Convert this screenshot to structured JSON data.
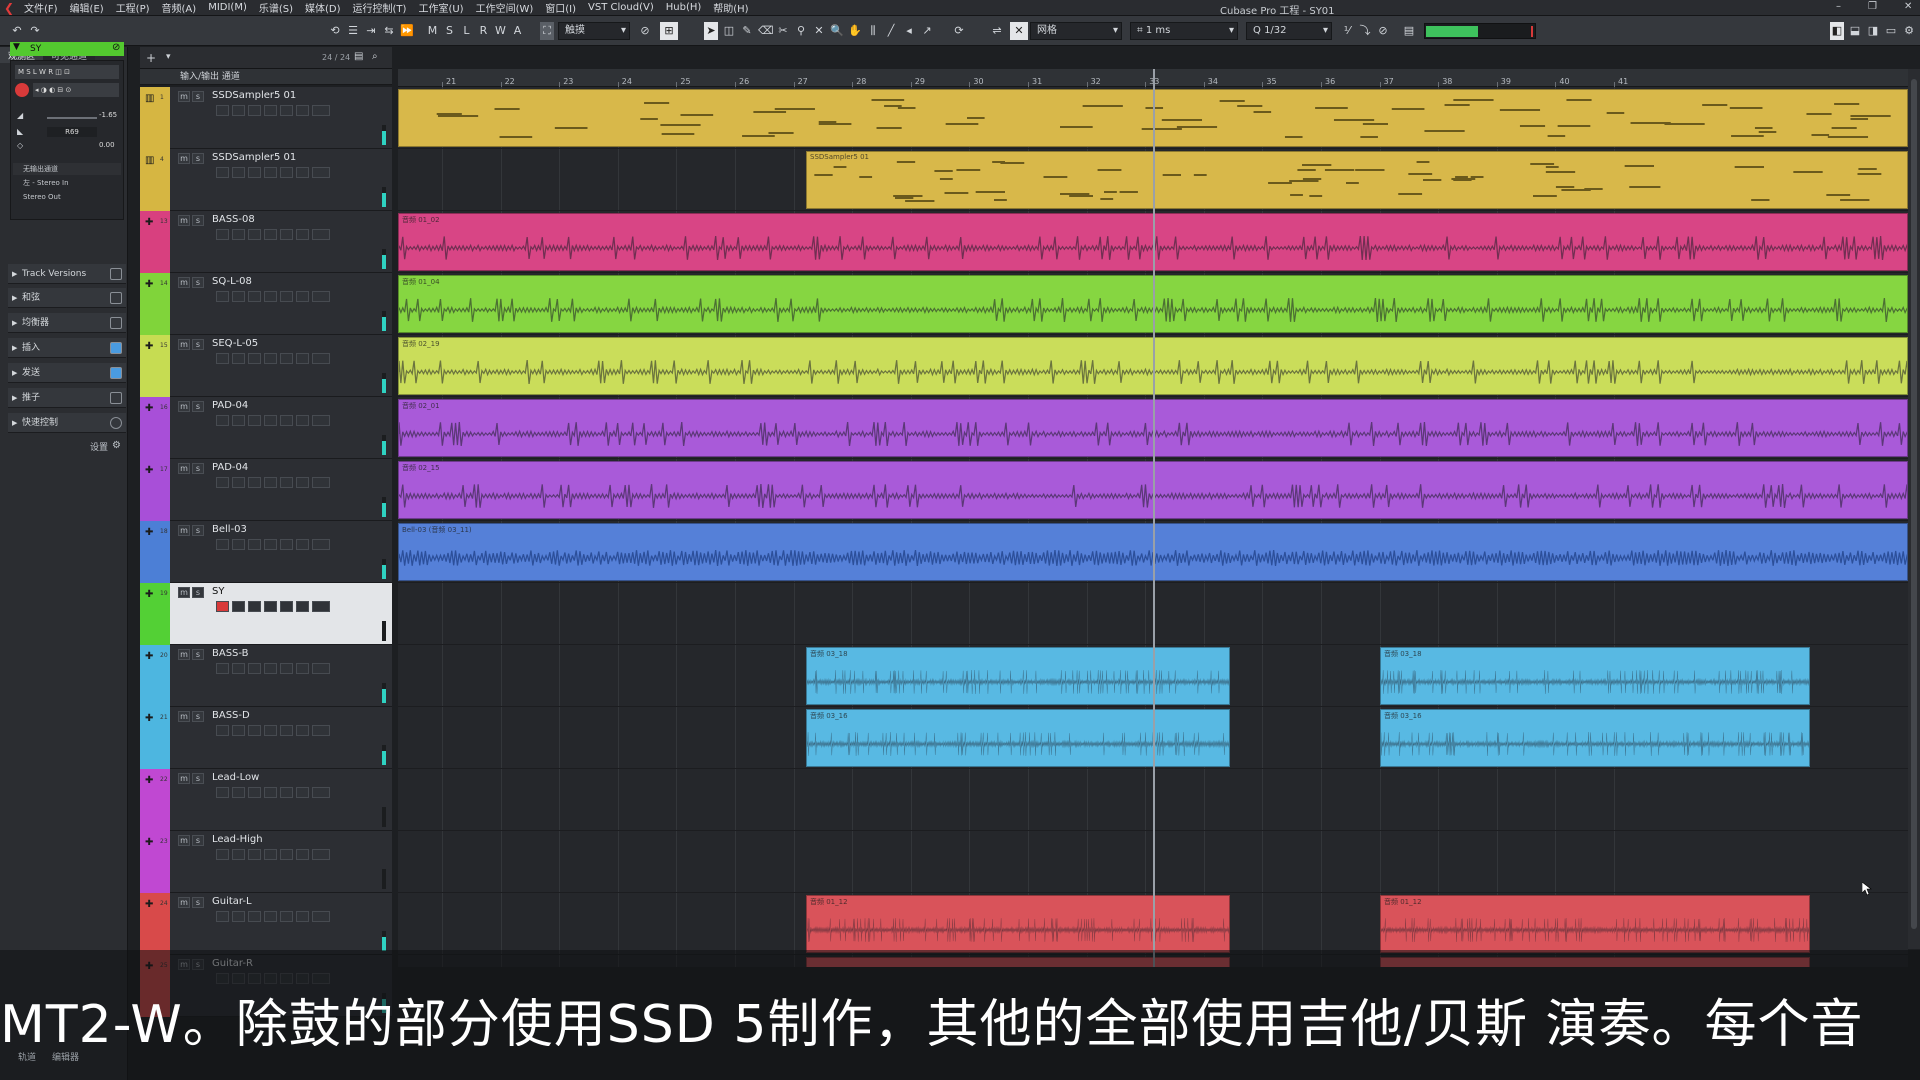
{
  "menubar": {
    "items": [
      "文件(F)",
      "编辑(E)",
      "工程(P)",
      "音频(A)",
      "MIDI(M)",
      "乐谱(S)",
      "媒体(D)",
      "运行控制(T)",
      "工作室(U)",
      "工作空间(W)",
      "窗口(I)",
      "VST Cloud(V)",
      "Hub(H)",
      "帮助(H)"
    ],
    "window_title": "Cubase Pro 工程 - SY01"
  },
  "toolbar": {
    "ms_buttons": [
      "M",
      "S",
      "L",
      "R",
      "W",
      "A"
    ],
    "touch_mode": "触摸",
    "grid_mode": "网格",
    "quantize_nudge": "1 ms",
    "quantize": "1/32"
  },
  "leftzone": {
    "tabs": [
      "观测区",
      "可见通道"
    ],
    "selected_track": "SY",
    "routing": [
      "无输出通道",
      "左 - Stereo In",
      "Stereo Out"
    ],
    "volume": "-1.65",
    "pan": "R69",
    "value2": "0.00",
    "sections": [
      "Track Versions",
      "和弦",
      "均衡器",
      "插入",
      "发送",
      "推子",
      "快速控制"
    ],
    "settings_label": "设置"
  },
  "tracklist": {
    "header": "输入/输出 通道",
    "count": "24 / 24",
    "tracks": [
      {
        "name": "SSDSampler5 01",
        "num": "1",
        "color": "#d6b642"
      },
      {
        "name": "SSDSampler5 01",
        "num": "4",
        "color": "#d6b642"
      },
      {
        "name": "BASS-08",
        "num": "13",
        "color": "#d8407f"
      },
      {
        "name": "SQ-L-08",
        "num": "14",
        "color": "#80d43a"
      },
      {
        "name": "SEQ-L-05",
        "num": "15",
        "color": "#c6dc52"
      },
      {
        "name": "PAD-04",
        "num": "16",
        "color": "#a84fd8"
      },
      {
        "name": "PAD-04",
        "num": "17",
        "color": "#a84fd8"
      },
      {
        "name": "Bell-03",
        "num": "18",
        "color": "#4c7fd6"
      },
      {
        "name": "SY",
        "num": "19",
        "color": "#53d035"
      },
      {
        "name": "BASS-B",
        "num": "20",
        "color": "#4db6e0"
      },
      {
        "name": "BASS-D",
        "num": "21",
        "color": "#4db6e0"
      },
      {
        "name": "Lead-Low",
        "num": "22",
        "color": "#c048d2"
      },
      {
        "name": "Lead-High",
        "num": "23",
        "color": "#c048d2"
      },
      {
        "name": "Guitar-L",
        "num": "24",
        "color": "#d84a4a"
      },
      {
        "name": "Guitar-R",
        "num": "25",
        "color": "#d84a4a"
      }
    ]
  },
  "ruler": {
    "bars": [
      "21",
      "22",
      "23",
      "24",
      "25",
      "26",
      "27",
      "28",
      "29",
      "30",
      "31",
      "32",
      "33",
      "34",
      "35",
      "36",
      "37",
      "38",
      "39",
      "40",
      "41"
    ]
  },
  "events": {
    "ssd2": "SSDSampler5 01",
    "bass08": "音频 01_02",
    "sql08": "音频 01_04",
    "seql05": "音频 02_19",
    "pad1": "音频 02_01",
    "pad2": "音频 02_15",
    "bell": "Bell-03 (音频 03_11)",
    "bassb": "音频 03_18",
    "bassd": "音频 03_16",
    "guitar": "音频 01_12"
  },
  "subtitle": "MT2-W。除鼓的部分使用SSD 5制作，其他的全部使用吉他/贝斯 演奏。每个音",
  "bottom_tabs": [
    "轨道",
    "编辑器"
  ]
}
